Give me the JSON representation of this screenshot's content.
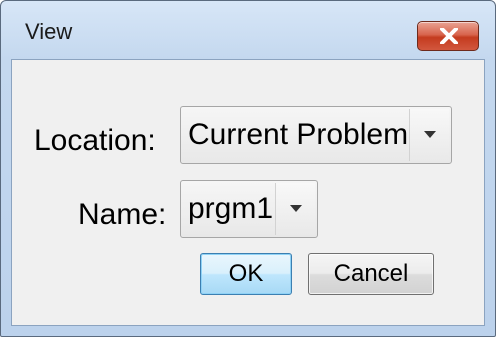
{
  "window": {
    "title": "View"
  },
  "form": {
    "location_label": "Location:",
    "location_value": "Current Problem",
    "name_label": "Name:",
    "name_value": "prgm1"
  },
  "buttons": {
    "ok_label": "OK",
    "cancel_label": "Cancel"
  },
  "icons": {
    "close": "close-icon",
    "dropdown": "chevron-down-icon"
  },
  "colors": {
    "close_button": "#c94a30",
    "default_button_border": "#3c7fb1",
    "titlebar": "#c4d8ef"
  }
}
